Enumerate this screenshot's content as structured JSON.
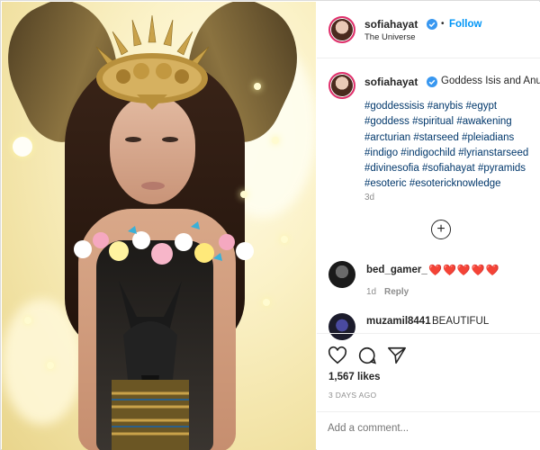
{
  "post": {
    "image_alt": "",
    "author": {
      "username": "sofiahayat",
      "location": "The Universe",
      "follow_label": "Follow",
      "dot": "•"
    },
    "caption": {
      "username": "sofiahayat",
      "text": "Goddess Isis and Anubis",
      "hashtags": [
        "#goddessisis",
        "#anybis",
        "#egypt",
        "#goddess",
        "#spiritual",
        "#awakening",
        "#arcturian",
        "#starseed",
        "#pleiadians",
        "#indigo",
        "#indigochild",
        "#lyrianstarseed",
        "#divinesofia",
        "#sofiahayat",
        "#pyramids",
        "#esoteric",
        "#esotericknowledge"
      ],
      "age": "3d"
    },
    "load_more_icon": "plus-circle-icon",
    "comments": [
      {
        "username": "bed_gamer_",
        "text": "",
        "hearts": "❤️❤️❤️❤️❤️",
        "age": "1d",
        "reply_label": "Reply"
      },
      {
        "username": "muzamil8441",
        "text": "BEAUTIFUL",
        "hearts": "",
        "age": "",
        "reply_label": ""
      }
    ],
    "actions": {
      "like_icon": "heart-icon",
      "comment_icon": "comment-icon",
      "share_icon": "send-icon",
      "likes": "1,567 likes",
      "date": "3 DAYS AGO"
    },
    "add_comment_placeholder": "Add a comment..."
  },
  "colors": {
    "link": "#0095f6",
    "hashtag": "#00376b",
    "muted": "#8e8e8e",
    "heart": "#ed4956",
    "border": "#dbdbdb"
  }
}
